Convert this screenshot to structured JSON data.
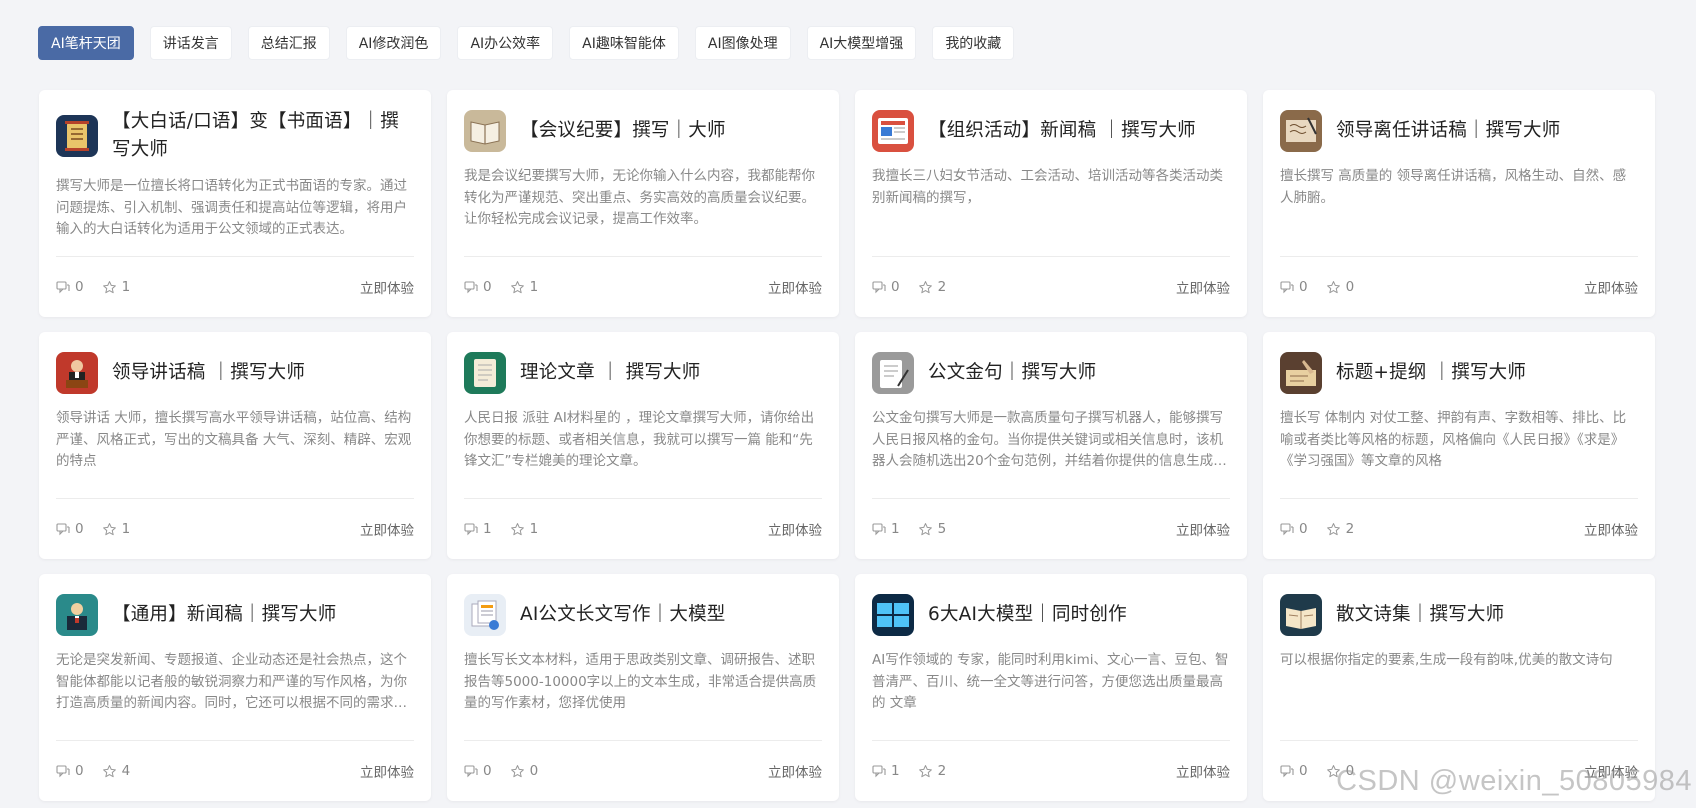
{
  "tabs": [
    {
      "label": "AI笔杆天团",
      "active": true
    },
    {
      "label": "讲话发言",
      "active": false
    },
    {
      "label": "总结汇报",
      "active": false
    },
    {
      "label": "AI修改润色",
      "active": false
    },
    {
      "label": "AI办公效率",
      "active": false
    },
    {
      "label": "AI趣味智能体",
      "active": false
    },
    {
      "label": "AI图像处理",
      "active": false
    },
    {
      "label": "AI大模型增强",
      "active": false
    },
    {
      "label": "我的收藏",
      "active": false
    }
  ],
  "cta_label": "立即体验",
  "colors": {
    "accent": "#4a6aa5",
    "background": "#f3f4f7"
  },
  "cards": [
    {
      "title": "【大白话/口语】变【书面语】｜撰写大师",
      "desc": "撰写大师是一位擅长将口语转化为正式书面语的专家。通过问题提炼、引入机制、强调责任和提高站位等逻辑，将用户输入的大白话转化为适用于公文领域的正式表达。",
      "comments": "0",
      "stars": "1",
      "icon": "document-scroll-icon",
      "icon_bg": "#1d3557",
      "icon_fg": "#e9c46a"
    },
    {
      "title": "【会议纪要】撰写｜大师",
      "desc": "我是会议纪要撰写大师，无论你输入什么内容，我都能帮你转化为严谨规范、突出重点、务实高效的高质量会议纪要。让你轻松完成会议记录，提高工作效率。",
      "comments": "0",
      "stars": "1",
      "icon": "open-book-icon",
      "icon_bg": "#c9b99a",
      "icon_fg": "#f5efe2"
    },
    {
      "title": "【组织活动】新闻稿 ｜撰写大师",
      "desc": "我擅长三八妇女节活动、工会活动、培训活动等各类活动类别新闻稿的撰写，",
      "comments": "0",
      "stars": "2",
      "icon": "newspaper-icon",
      "icon_bg": "#d9503f",
      "icon_fg": "#ffffff"
    },
    {
      "title": "领导离任讲话稿｜撰写大师",
      "desc": "擅长撰写 高质量的 领导离任讲话稿，风格生动、自然、感人肺腑。",
      "comments": "0",
      "stars": "0",
      "icon": "handwriting-icon",
      "icon_bg": "#8a6a4a",
      "icon_fg": "#e8d8c0"
    },
    {
      "title": "领导讲话稿 ｜撰写大师",
      "desc": "领导讲话 大师，擅长撰写高水平领导讲话稿，站位高、结构严谨、风格正式，写出的文稿具备 大气、深刻、精辟、宏观的特点",
      "comments": "0",
      "stars": "1",
      "icon": "speaker-podium-icon",
      "icon_bg": "#c0392b",
      "icon_fg": "#f1c40f"
    },
    {
      "title": "理论文章 ｜ 撰写大师",
      "desc": "人民日报 派驻 AI材料星的 ，理论文章撰写大师，请你给出你想要的标题、或者相关信息，我就可以撰写一篇 能和“先锋文汇”专栏媲美的理论文章。",
      "comments": "1",
      "stars": "1",
      "icon": "notebook-icon",
      "icon_bg": "#1e7a5a",
      "icon_fg": "#f4ecd8"
    },
    {
      "title": "公文金句｜撰写大师",
      "desc": "公文金句撰写大师是一款高质量句子撰写机器人，能够撰写人民日报风格的金句。当你提供关键词或相关信息时，该机器人会随机选出20个金句范例，并结着你提供的信息生成新的金句。",
      "comments": "1",
      "stars": "5",
      "icon": "document-pen-icon",
      "icon_bg": "#9a9a9a",
      "icon_fg": "#ffffff"
    },
    {
      "title": "标题+提纲 ｜撰写大师",
      "desc": "擅长写 体制内 对仗工整、押韵有声、字数相等、排比、比喻或者类比等风格的标题，风格偏向《人民日报》《求是》《学习强国》等文章的风格",
      "comments": "0",
      "stars": "2",
      "icon": "writing-hand-icon",
      "icon_bg": "#5a4030",
      "icon_fg": "#e8d0a0"
    },
    {
      "title": "【通用】新闻稿｜撰写大师",
      "desc": "无论是突发新闻、专题报道、企业动态还是社会热点，这个智能体都能以记者般的敏锐洞察力和严谨的写作风格，为你打造高质量的新闻内容。同时，它还可以根据不同的需求调整写作风格。",
      "comments": "0",
      "stars": "4",
      "icon": "news-anchor-icon",
      "icon_bg": "#2a8a8a",
      "icon_fg": "#f0d0a0"
    },
    {
      "title": "AI公文长文写作｜大模型",
      "desc": "擅长写长文本材料，适用于思政类别文章、调研报告、述职报告等5000-10000字以上的文本生成，非常适合提供高质量的写作素材，您择优使用",
      "comments": "0",
      "stars": "0",
      "icon": "documents-stack-icon",
      "icon_bg": "#e8eef5",
      "icon_fg": "#f39c12"
    },
    {
      "title": "6大AI大模型｜同时创作",
      "desc": "AI写作领域的 专家，能同时利用kimi、文心一言、豆包、智普清严、百川、统一全文等进行问答，方便您选出质量最高的 文章",
      "comments": "1",
      "stars": "2",
      "icon": "monitors-icon",
      "icon_bg": "#0d2a45",
      "icon_fg": "#4fc3f7"
    },
    {
      "title": "散文诗集｜撰写大师",
      "desc": "可以根据你指定的要素,生成一段有韵味,优美的散文诗句",
      "comments": "0",
      "stars": "0",
      "icon": "poetry-book-icon",
      "icon_bg": "#1f3a4a",
      "icon_fg": "#f5e6c8"
    }
  ],
  "watermark": "CSDN @weixin_50805984"
}
